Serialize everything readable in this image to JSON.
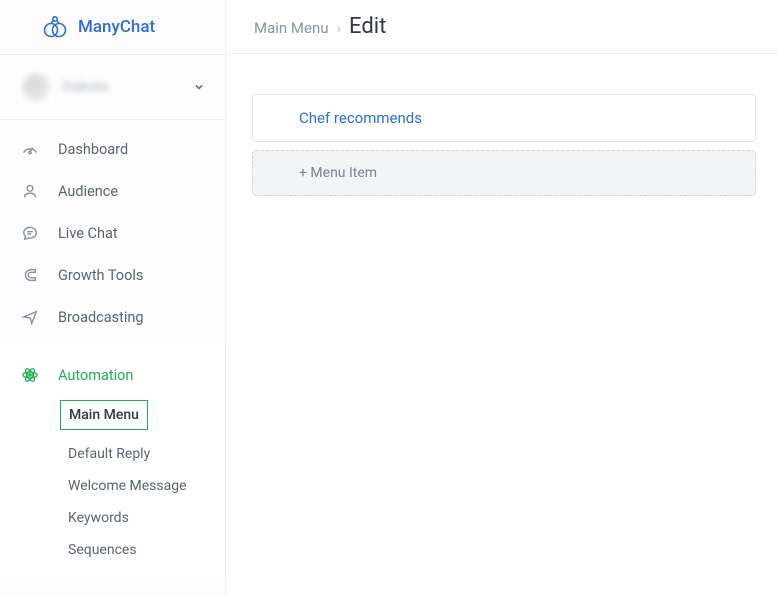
{
  "brand": {
    "name": "ManyChat"
  },
  "user": {
    "name": "Oakots"
  },
  "nav": {
    "dashboard": "Dashboard",
    "audience": "Audience",
    "livechat": "Live Chat",
    "growth": "Growth Tools",
    "broadcasting": "Broadcasting",
    "automation": "Automation"
  },
  "automation_sub": {
    "main_menu": "Main Menu",
    "default_reply": "Default Reply",
    "welcome": "Welcome Message",
    "keywords": "Keywords",
    "sequences": "Sequences"
  },
  "breadcrumb": {
    "parent": "Main Menu",
    "current": "Edit"
  },
  "menu_items": {
    "item0": "Chef recommends",
    "add_label": "+ Menu Item"
  }
}
